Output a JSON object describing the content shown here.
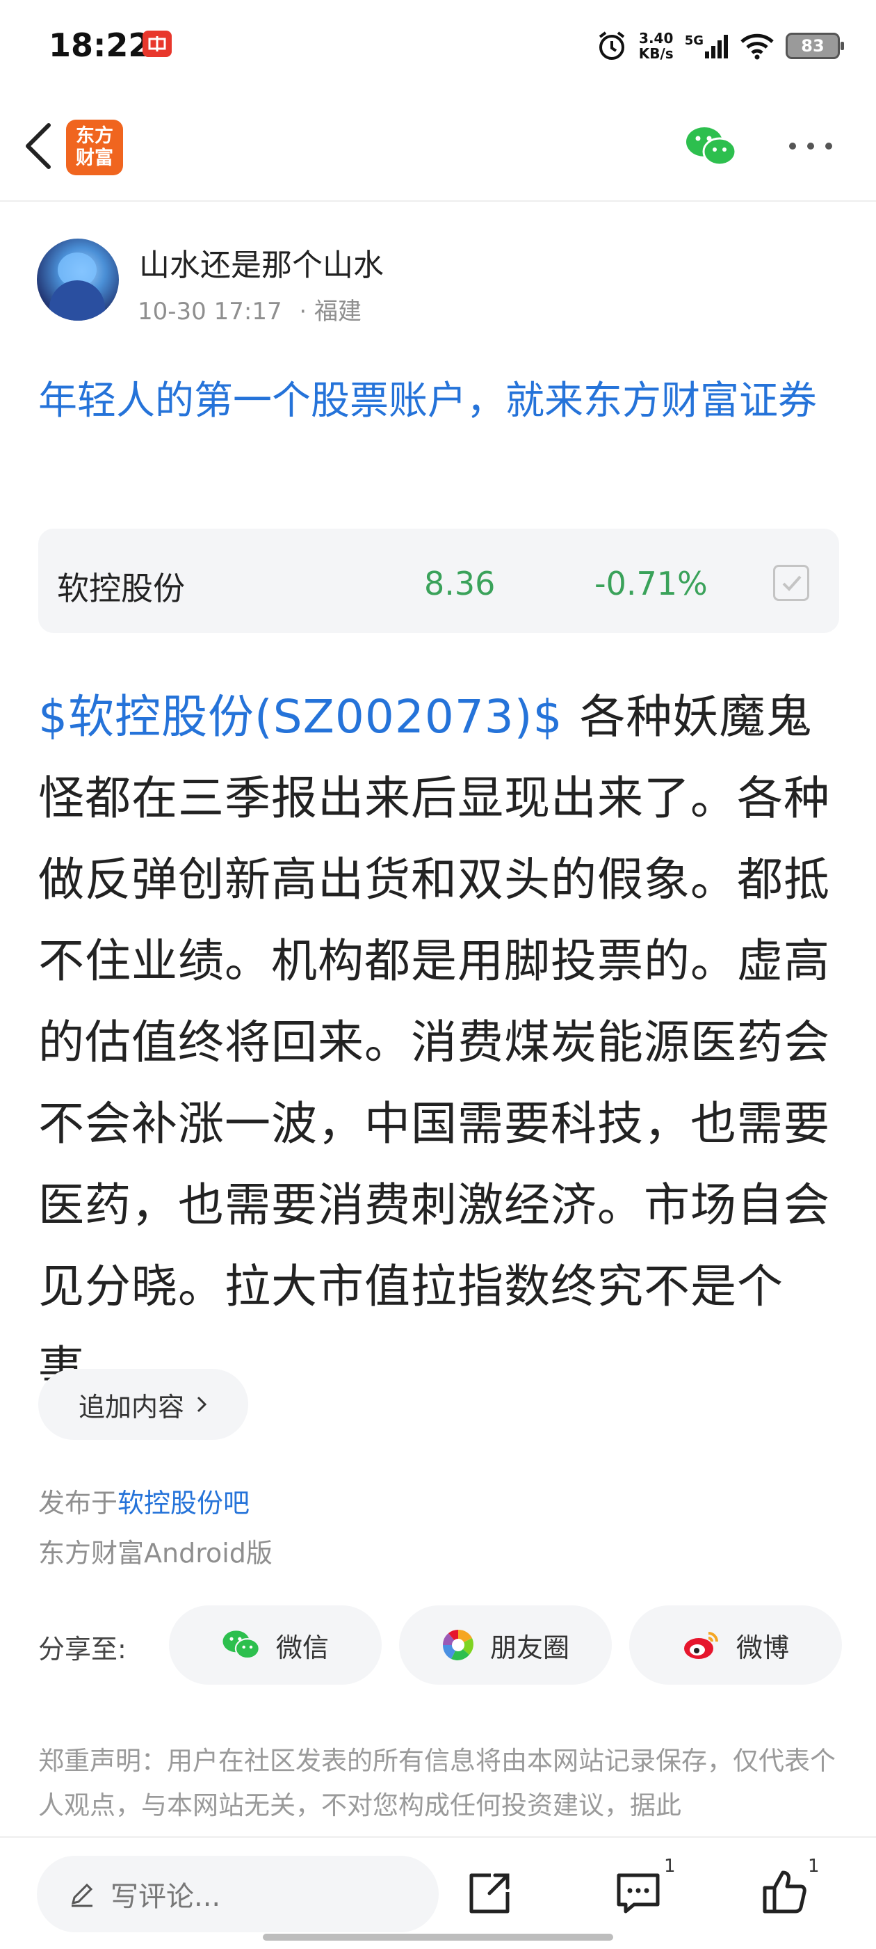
{
  "status_bar": {
    "time": "18:22",
    "net_speed_value": "3.40",
    "net_speed_unit": "KB/s",
    "network": "5G",
    "battery": "83"
  },
  "nav": {
    "logo_line1": "东方",
    "logo_line2": "财富"
  },
  "author": {
    "name": "山水还是那个山水",
    "datetime": "10-30 17:17",
    "location": "· 福建"
  },
  "post": {
    "title": "年轻人的第一个股票账户，就来东方财富证券",
    "stock_tag": "$软控股份(SZ002073)$",
    "body": "各种妖魔鬼怪都在三季报出来后显现出来了。各种做反弹创新高出货和双头的假象。都抵不住业绩。机构都是用脚投票的。虚高的估值终将回来。消费煤炭能源医药会不会补涨一波，中国需要科技，也需要医药，也需要消费刺激经济。市场自会见分晓。拉大市值拉指数终究不是个事。"
  },
  "stock_card": {
    "name": "软控股份",
    "price": "8.36",
    "change": "-0.71%"
  },
  "add_content": "追加内容",
  "published_prefix": "发布于",
  "published_bar": "软控股份吧",
  "client": "东方财富Android版",
  "share": {
    "label": "分享至:",
    "wechat": "微信",
    "moments": "朋友圈",
    "weibo": "微博"
  },
  "disclaimer": "郑重声明：用户在社区发表的所有信息将由本网站记录保存，仅代表个人观点，与本网站无关，不对您构成任何投资建议，据此",
  "bottom_bar": {
    "comment_placeholder": "写评论...",
    "comment_count": "1",
    "like_count": "1"
  },
  "colors": {
    "link_blue": "#2573d9",
    "stock_green": "#3aa25a",
    "brand_orange": "#f0651f",
    "wechat_green": "#2dbf4e",
    "weibo_red": "#e6162d"
  }
}
